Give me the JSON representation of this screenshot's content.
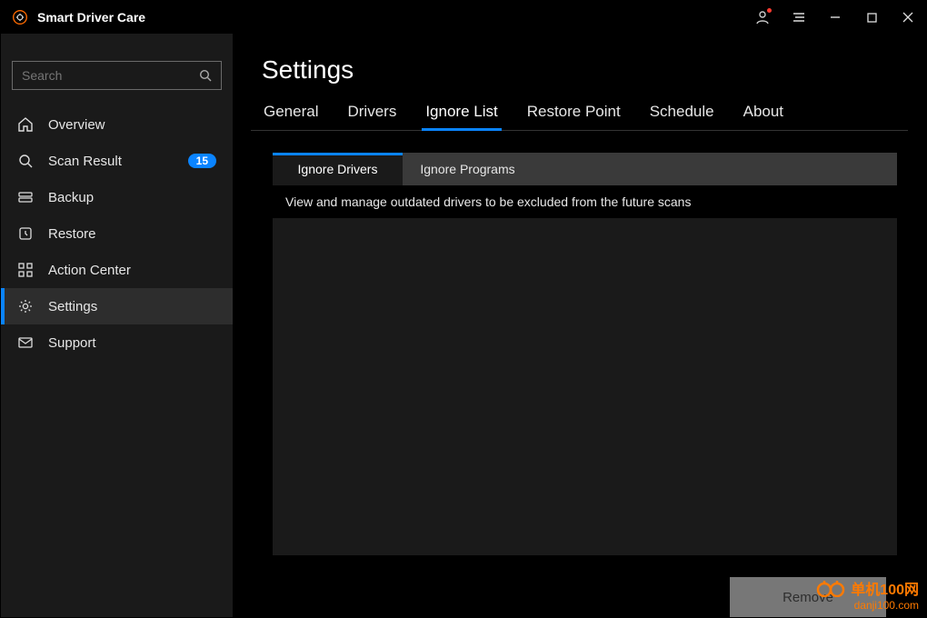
{
  "app_title": "Smart Driver Care",
  "titlebar": {
    "user_tooltip": "Account",
    "menu_tooltip": "Menu",
    "min_tooltip": "Minimize",
    "max_tooltip": "Maximize",
    "close_tooltip": "Close"
  },
  "search": {
    "placeholder": "Search"
  },
  "sidebar": {
    "items": [
      {
        "label": "Overview",
        "icon": "home-icon",
        "badge": null,
        "active": false
      },
      {
        "label": "Scan Result",
        "icon": "search-icon",
        "badge": "15",
        "active": false
      },
      {
        "label": "Backup",
        "icon": "backup-icon",
        "badge": null,
        "active": false
      },
      {
        "label": "Restore",
        "icon": "restore-icon",
        "badge": null,
        "active": false
      },
      {
        "label": "Action Center",
        "icon": "grid-icon",
        "badge": null,
        "active": false
      },
      {
        "label": "Settings",
        "icon": "gear-icon",
        "badge": null,
        "active": true
      },
      {
        "label": "Support",
        "icon": "mail-icon",
        "badge": null,
        "active": false
      }
    ]
  },
  "page": {
    "title": "Settings",
    "tabs": [
      {
        "label": "General",
        "active": false
      },
      {
        "label": "Drivers",
        "active": false
      },
      {
        "label": "Ignore List",
        "active": true
      },
      {
        "label": "Restore Point",
        "active": false
      },
      {
        "label": "Schedule",
        "active": false
      },
      {
        "label": "About",
        "active": false
      }
    ],
    "subtabs": [
      {
        "label": "Ignore Drivers",
        "active": true
      },
      {
        "label": "Ignore Programs",
        "active": false
      }
    ],
    "list_description": "View and manage outdated drivers to be excluded from the future scans",
    "remove_button": "Remove"
  },
  "watermark": {
    "line1": "单机100网",
    "line2": "danji100.com"
  }
}
